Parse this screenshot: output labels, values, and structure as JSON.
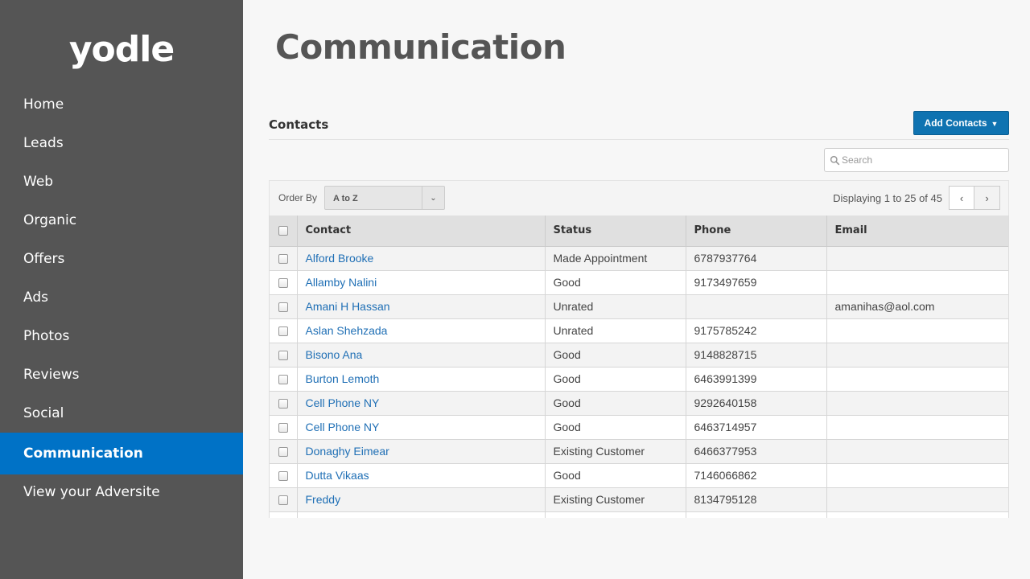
{
  "brand": {
    "logo_text": "yodle"
  },
  "sidebar": {
    "items": [
      {
        "label": "Home"
      },
      {
        "label": "Leads"
      },
      {
        "label": "Web"
      },
      {
        "label": "Organic"
      },
      {
        "label": "Offers"
      },
      {
        "label": "Ads"
      },
      {
        "label": "Photos"
      },
      {
        "label": "Reviews"
      },
      {
        "label": "Social"
      },
      {
        "label": "Communication",
        "active": true
      },
      {
        "label": "View your Adversite"
      }
    ]
  },
  "page": {
    "title": "Communication"
  },
  "contacts": {
    "section_title": "Contacts",
    "add_button_label": "Add Contacts",
    "search_placeholder": "Search",
    "order_by_label": "Order By",
    "order_by_value": "A to Z",
    "displaying_text": "Displaying 1 to 25 of 45",
    "columns": [
      "Contact",
      "Status",
      "Phone",
      "Email"
    ],
    "rows": [
      {
        "contact": "Alford Brooke",
        "status": "Made Appointment",
        "phone": "6787937764",
        "email": ""
      },
      {
        "contact": "Allamby Nalini",
        "status": "Good",
        "phone": "9173497659",
        "email": ""
      },
      {
        "contact": "Amani H Hassan",
        "status": "Unrated",
        "phone": "",
        "email": "amanihas@aol.com"
      },
      {
        "contact": "Aslan Shehzada",
        "status": "Unrated",
        "phone": "9175785242",
        "email": ""
      },
      {
        "contact": "Bisono Ana",
        "status": "Good",
        "phone": "9148828715",
        "email": ""
      },
      {
        "contact": "Burton Lemoth",
        "status": "Good",
        "phone": "6463991399",
        "email": ""
      },
      {
        "contact": "Cell Phone NY",
        "status": "Good",
        "phone": "9292640158",
        "email": ""
      },
      {
        "contact": "Cell Phone NY",
        "status": "Good",
        "phone": "6463714957",
        "email": ""
      },
      {
        "contact": "Donaghy Eimear",
        "status": "Existing Customer",
        "phone": "6466377953",
        "email": ""
      },
      {
        "contact": "Dutta Vikaas",
        "status": "Good",
        "phone": "7146066862",
        "email": ""
      },
      {
        "contact": "Freddy",
        "status": "Existing Customer",
        "phone": "8134795128",
        "email": ""
      },
      {
        "contact": "",
        "status": "",
        "phone": "",
        "email": ""
      }
    ]
  },
  "colors": {
    "sidebar_bg": "#555555",
    "active_nav": "#0072c6",
    "primary_button": "#0f73b1",
    "link": "#1f6fb5"
  },
  "icons": {
    "search": "search-icon",
    "dropdown": "chevron-down-icon",
    "prev": "chevron-left-icon",
    "next": "chevron-right-icon"
  }
}
